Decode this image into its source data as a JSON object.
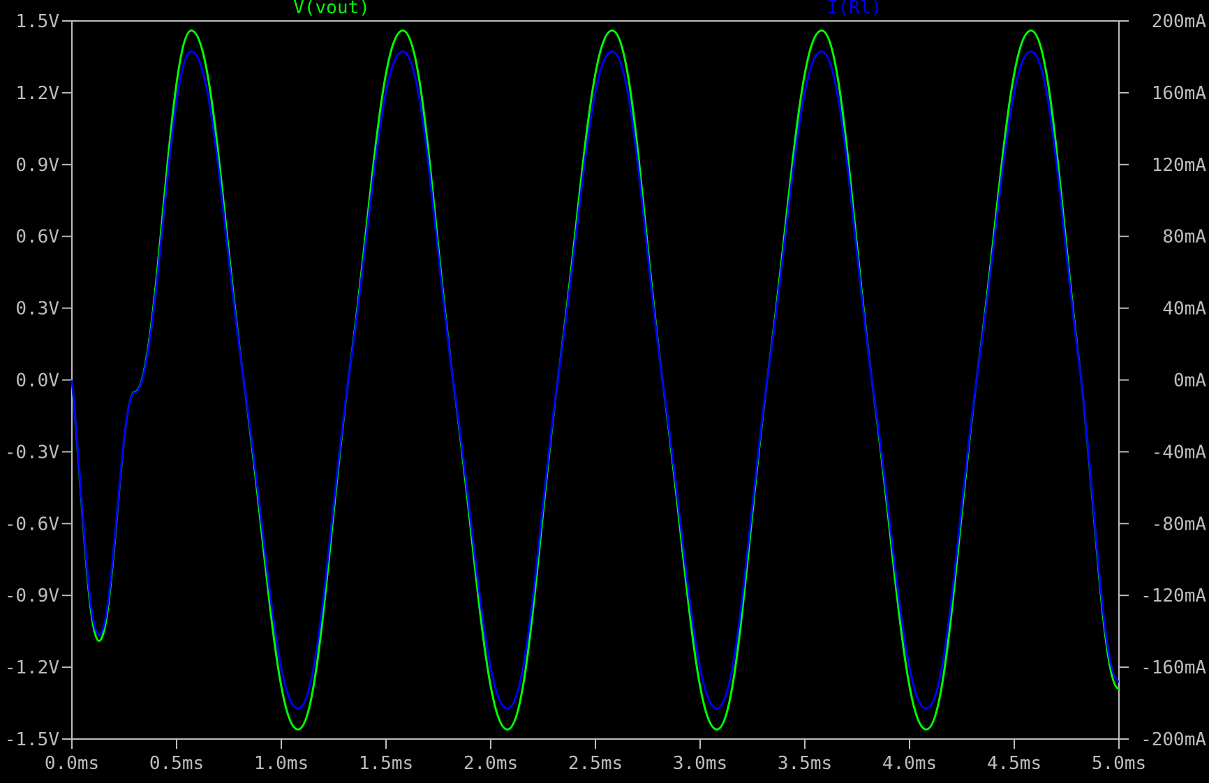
{
  "chart_data": {
    "type": "line",
    "x_unit": "ms",
    "x_range": [
      0.0,
      5.0
    ],
    "x_ticks": [
      "0.0ms",
      "0.5ms",
      "1.0ms",
      "1.5ms",
      "2.0ms",
      "2.5ms",
      "3.0ms",
      "3.5ms",
      "4.0ms",
      "4.5ms",
      "5.0ms"
    ],
    "left_axis": {
      "range": [
        -1.5,
        1.5
      ],
      "ticks": [
        "1.5V",
        "1.2V",
        "0.9V",
        "0.6V",
        "0.3V",
        "0.0V",
        "-0.3V",
        "-0.6V",
        "-0.9V",
        "-1.2V",
        "-1.5V"
      ]
    },
    "right_axis": {
      "range": [
        -200,
        200
      ],
      "ticks": [
        "200mA",
        "160mA",
        "120mA",
        "80mA",
        "40mA",
        "0mA",
        "-40mA",
        "-80mA",
        "-120mA",
        "-160mA",
        "-200mA"
      ]
    },
    "series": [
      {
        "name": "V(vout)",
        "axis": "left",
        "color": "#00ff00",
        "points": [
          [
            0.0,
            0.0
          ],
          [
            0.13,
            -1.09
          ],
          [
            0.3,
            -0.05
          ],
          [
            0.57,
            1.46
          ],
          [
            0.82,
            0.0
          ],
          [
            1.08,
            -1.46
          ],
          [
            1.32,
            0.0
          ],
          [
            1.58,
            1.46
          ],
          [
            1.82,
            0.0
          ],
          [
            2.08,
            -1.46
          ],
          [
            2.32,
            0.0
          ],
          [
            2.58,
            1.46
          ],
          [
            2.82,
            0.0
          ],
          [
            3.08,
            -1.46
          ],
          [
            3.32,
            0.0
          ],
          [
            3.58,
            1.46
          ],
          [
            3.82,
            0.0
          ],
          [
            4.08,
            -1.46
          ],
          [
            4.32,
            0.0
          ],
          [
            4.58,
            1.46
          ],
          [
            4.82,
            0.0
          ],
          [
            5.0,
            -1.29
          ]
        ]
      },
      {
        "name": "I(Rl)",
        "axis": "right",
        "color": "#0000ff",
        "points": [
          [
            0.0,
            0.0
          ],
          [
            0.13,
            -142
          ],
          [
            0.3,
            -7
          ],
          [
            0.57,
            183
          ],
          [
            0.82,
            0
          ],
          [
            1.08,
            -183
          ],
          [
            1.32,
            0
          ],
          [
            1.58,
            183
          ],
          [
            1.82,
            0
          ],
          [
            2.08,
            -183
          ],
          [
            2.32,
            0
          ],
          [
            2.58,
            183
          ],
          [
            2.82,
            0
          ],
          [
            3.08,
            -183
          ],
          [
            3.32,
            0
          ],
          [
            3.58,
            183
          ],
          [
            3.82,
            0
          ],
          [
            4.08,
            -183
          ],
          [
            4.32,
            0
          ],
          [
            4.58,
            183
          ],
          [
            4.82,
            0
          ],
          [
            5.0,
            -168
          ]
        ]
      }
    ]
  }
}
